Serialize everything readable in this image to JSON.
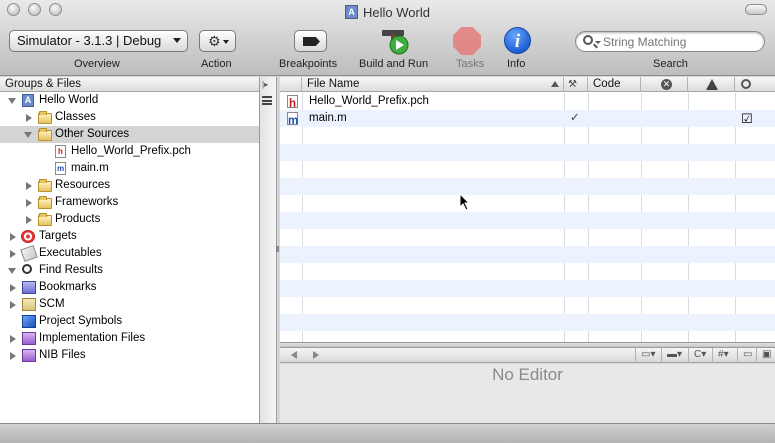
{
  "window": {
    "title": "Hello World"
  },
  "toolbar": {
    "overview_popup": "Simulator - 3.1.3 | Debug",
    "overview_label": "Overview",
    "action_label": "Action",
    "breakpoints_label": "Breakpoints",
    "build_run_label": "Build and Run",
    "tasks_label": "Tasks",
    "info_label": "Info",
    "search_label": "Search",
    "search_placeholder": "String Matching",
    "info_glyph": "i"
  },
  "sidebar": {
    "header": "Groups & Files",
    "items": [
      {
        "label": "Hello World",
        "icon": "project-icon"
      },
      {
        "label": "Classes",
        "icon": "folder-icon"
      },
      {
        "label": "Other Sources",
        "icon": "folder-icon"
      },
      {
        "label": "Hello_World_Prefix.pch",
        "icon": "header-file-icon"
      },
      {
        "label": "main.m",
        "icon": "source-file-icon"
      },
      {
        "label": "Resources",
        "icon": "folder-icon"
      },
      {
        "label": "Frameworks",
        "icon": "folder-icon"
      },
      {
        "label": "Products",
        "icon": "folder-icon"
      },
      {
        "label": "Targets",
        "icon": "target-icon"
      },
      {
        "label": "Executables",
        "icon": "executable-icon"
      },
      {
        "label": "Find Results",
        "icon": "magnifier-icon"
      },
      {
        "label": "Bookmarks",
        "icon": "bookmark-icon"
      },
      {
        "label": "SCM",
        "icon": "scm-icon"
      },
      {
        "label": "Project Symbols",
        "icon": "cube-icon"
      },
      {
        "label": "Implementation Files",
        "icon": "smart-group-icon"
      },
      {
        "label": "NIB Files",
        "icon": "smart-group-icon"
      }
    ]
  },
  "file_list": {
    "columns": [
      "File Name",
      "Code"
    ],
    "rows": [
      {
        "name": "Hello_World_Prefix.pch",
        "icon": "header-file-icon",
        "built": "",
        "checked": ""
      },
      {
        "name": "main.m",
        "icon": "source-file-icon",
        "built": "✓",
        "checked": "☑"
      }
    ],
    "file_glyph_h": "h",
    "file_glyph_m": "m",
    "project_glyph": "A",
    "error_glyph": "✕"
  },
  "editor": {
    "placeholder": "No Editor",
    "popups": [
      "C",
      "#"
    ]
  },
  "colors": {
    "selection": "#d4d4d4",
    "row_stripe": "#edf3fe",
    "info_blue": "#1d5fd6",
    "stop_red": "#e86a6a"
  }
}
